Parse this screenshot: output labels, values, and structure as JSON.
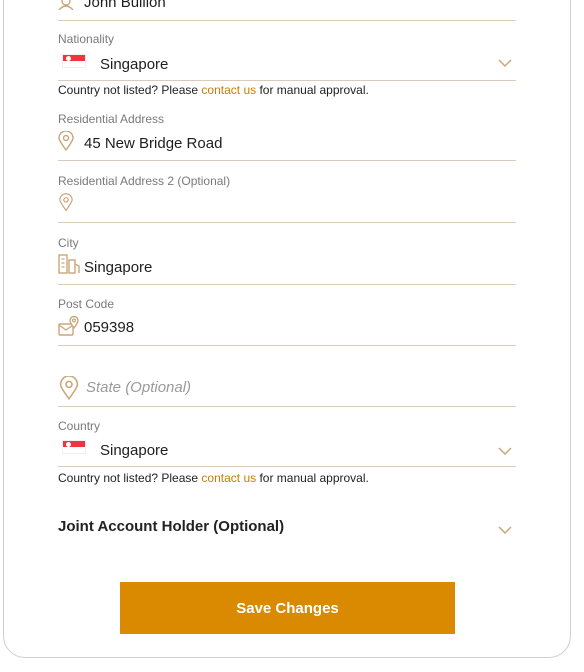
{
  "colors": {
    "accent": "#d98a00",
    "link": "#c97d00",
    "icon": "#c9a77a",
    "divider": "#d9cbb8"
  },
  "name_field": {
    "value": "John Bullion",
    "icon": "person-icon"
  },
  "nationality": {
    "label": "Nationality",
    "value": "Singapore",
    "flag": "singapore-flag"
  },
  "nationality_note": {
    "prefix": "Country not listed? Please ",
    "link": "contact us",
    "suffix": " for manual approval."
  },
  "address1": {
    "label": "Residential Address",
    "value": "45 New Bridge Road",
    "icon": "location-pin-icon"
  },
  "address2": {
    "label": "Residential Address 2 (Optional)",
    "value": "",
    "icon": "location-pin-icon"
  },
  "city": {
    "label": "City",
    "value": "Singapore",
    "icon": "buildings-icon"
  },
  "postcode": {
    "label": "Post Code",
    "value": "059398",
    "icon": "mail-location-icon"
  },
  "state": {
    "placeholder": "State (Optional)",
    "icon": "location-pin-icon"
  },
  "country": {
    "label": "Country",
    "value": "Singapore",
    "flag": "singapore-flag"
  },
  "country_note": {
    "prefix": "Country not listed? Please ",
    "link": "contact us",
    "suffix": " for manual approval."
  },
  "joint": {
    "label": "Joint Account Holder (Optional)"
  },
  "save_button": {
    "label": "Save Changes"
  }
}
